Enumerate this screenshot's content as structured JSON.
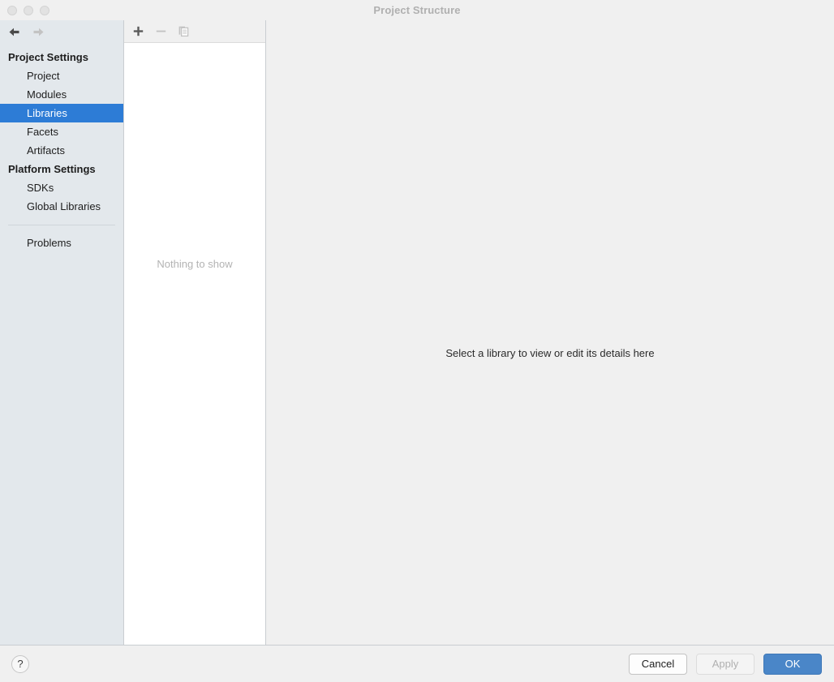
{
  "window": {
    "title": "Project Structure",
    "traffic_lights": [
      "close",
      "minimize",
      "zoom"
    ]
  },
  "sidebar": {
    "nav": {
      "back_icon": "arrow-left-icon",
      "back_enabled": true,
      "forward_icon": "arrow-right-icon",
      "forward_enabled": false
    },
    "sections": [
      {
        "header": "Project Settings",
        "items": [
          {
            "label": "Project",
            "selected": false
          },
          {
            "label": "Modules",
            "selected": false
          },
          {
            "label": "Libraries",
            "selected": true
          },
          {
            "label": "Facets",
            "selected": false
          },
          {
            "label": "Artifacts",
            "selected": false
          }
        ]
      },
      {
        "header": "Platform Settings",
        "items": [
          {
            "label": "SDKs",
            "selected": false
          },
          {
            "label": "Global Libraries",
            "selected": false
          }
        ]
      }
    ],
    "extra_items": [
      {
        "label": "Problems",
        "selected": false
      }
    ],
    "selection_color": "#2d7cd6",
    "background_color": "#e3e8ec"
  },
  "list_panel": {
    "toolbar": [
      {
        "icon": "plus-icon",
        "name": "add-library-button",
        "enabled": true
      },
      {
        "icon": "minus-icon",
        "name": "remove-library-button",
        "enabled": false
      },
      {
        "icon": "copy-icon",
        "name": "copy-library-button",
        "enabled": false
      }
    ],
    "empty_text": "Nothing to show"
  },
  "detail_pane": {
    "placeholder": "Select a library to view or edit its details here"
  },
  "footer": {
    "help_label": "?",
    "buttons": [
      {
        "label": "Cancel",
        "style": "secondary",
        "enabled": true
      },
      {
        "label": "Apply",
        "style": "disabled",
        "enabled": false
      },
      {
        "label": "OK",
        "style": "primary",
        "enabled": true
      }
    ],
    "primary_color": "#4a86c8"
  }
}
